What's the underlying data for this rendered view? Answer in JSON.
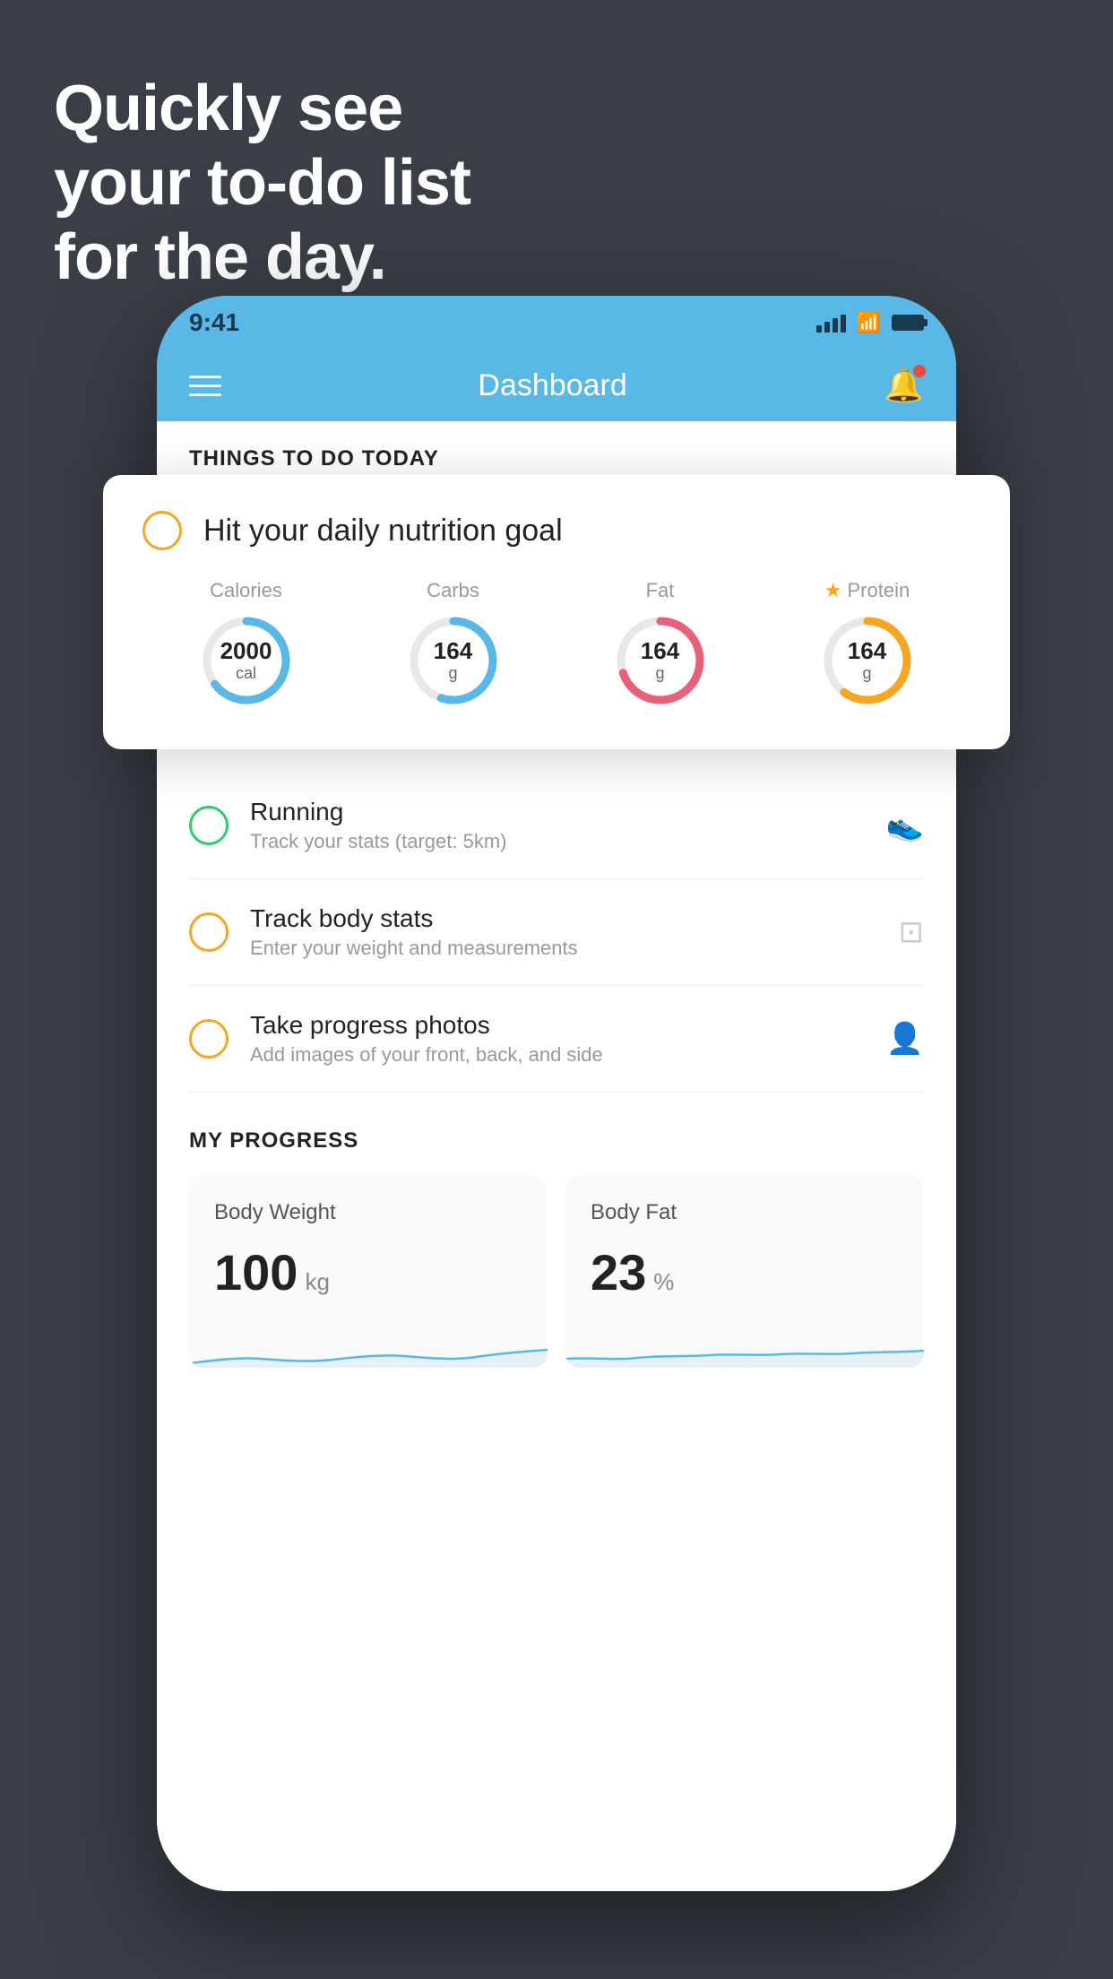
{
  "headline": {
    "line1": "Quickly see",
    "line2": "your to-do list",
    "line3": "for the day."
  },
  "status_bar": {
    "time": "9:41"
  },
  "header": {
    "title": "Dashboard"
  },
  "things_section": {
    "label": "THINGS TO DO TODAY"
  },
  "nutrition_card": {
    "title": "Hit your daily nutrition goal",
    "stats": [
      {
        "label": "Calories",
        "value": "2000",
        "unit": "cal",
        "color": "#5ab8e6",
        "percent": 65
      },
      {
        "label": "Carbs",
        "value": "164",
        "unit": "g",
        "color": "#5ab8e6",
        "percent": 55
      },
      {
        "label": "Fat",
        "value": "164",
        "unit": "g",
        "color": "#e8607a",
        "percent": 70
      },
      {
        "label": "Protein",
        "value": "164",
        "unit": "g",
        "color": "#f5a623",
        "percent": 60,
        "star": true
      }
    ]
  },
  "todo_items": [
    {
      "title": "Running",
      "subtitle": "Track your stats (target: 5km)",
      "check_color": "green",
      "icon": "👟"
    },
    {
      "title": "Track body stats",
      "subtitle": "Enter your weight and measurements",
      "check_color": "yellow",
      "icon": "⊡"
    },
    {
      "title": "Take progress photos",
      "subtitle": "Add images of your front, back, and side",
      "check_color": "yellow",
      "icon": "👤"
    }
  ],
  "progress_section": {
    "title": "MY PROGRESS",
    "cards": [
      {
        "title": "Body Weight",
        "value": "100",
        "unit": "kg"
      },
      {
        "title": "Body Fat",
        "value": "23",
        "unit": "%"
      }
    ]
  }
}
